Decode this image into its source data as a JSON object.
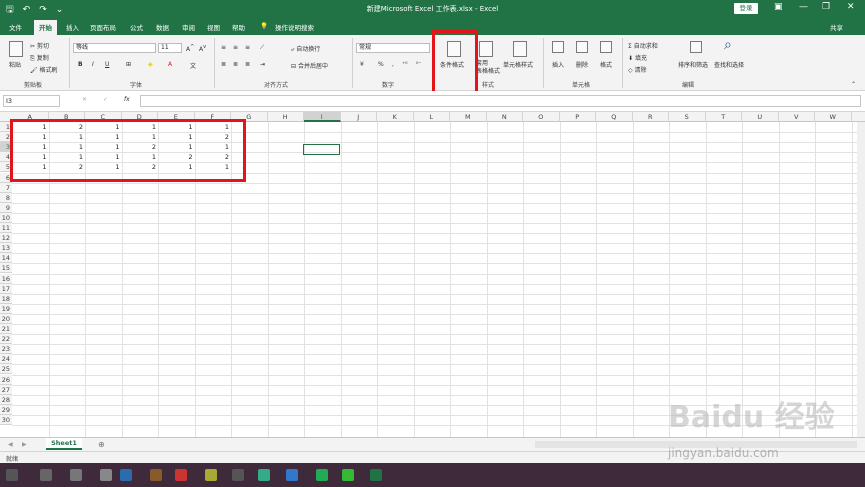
{
  "window": {
    "title": "新建Microsoft Excel 工作表.xlsx  -  Excel",
    "login_label": "登录"
  },
  "tabs": [
    "文件",
    "开始",
    "插入",
    "页面布局",
    "公式",
    "数据",
    "审阅",
    "视图",
    "帮助"
  ],
  "active_tab": "开始",
  "tell_me": "操作说明搜索",
  "share_label": "共享",
  "ribbon": {
    "clipboard": {
      "paste": "粘贴",
      "cut": "剪切",
      "copy": "复制",
      "format_painter": "格式刷",
      "label": "剪贴板"
    },
    "font": {
      "name": "等线",
      "size": "11",
      "label": "字体",
      "bold": "B",
      "italic": "I",
      "underline": "U"
    },
    "alignment": {
      "wrap": "自动换行",
      "merge": "合并后居中",
      "label": "对齐方式"
    },
    "number": {
      "format": "常规",
      "label": "数字"
    },
    "styles": {
      "conditional": "条件格式",
      "table_format": "套用\n表格格式",
      "cell_styles": "单元格样式",
      "label": "样式"
    },
    "cells": {
      "insert": "插入",
      "delete": "删除",
      "format": "格式",
      "label": "单元格"
    },
    "editing": {
      "autosum": "自动求和",
      "fill": "填充",
      "clear": "清除",
      "sort_filter": "排序和筛选",
      "find_select": "查找和选择",
      "label": "编辑"
    }
  },
  "formula_bar": {
    "name_box": "I3",
    "fx": "fx"
  },
  "columns": [
    "A",
    "B",
    "C",
    "D",
    "E",
    "F",
    "G",
    "H",
    "I",
    "J",
    "K",
    "L",
    "M",
    "N",
    "O",
    "P",
    "Q",
    "R",
    "S",
    "T",
    "U",
    "V",
    "W"
  ],
  "rows": [
    "1",
    "2",
    "3",
    "4",
    "5",
    "6",
    "7",
    "8",
    "9",
    "10",
    "11",
    "12",
    "13",
    "14",
    "15",
    "16",
    "17",
    "18",
    "19",
    "20",
    "21",
    "22",
    "23",
    "24",
    "25",
    "26",
    "27",
    "28",
    "29",
    "30"
  ],
  "cells": [
    [
      "1",
      "2",
      "1",
      "1",
      "1",
      "1"
    ],
    [
      "1",
      "1",
      "1",
      "1",
      "1",
      "2"
    ],
    [
      "1",
      "1",
      "1",
      "2",
      "1",
      "1"
    ],
    [
      "1",
      "1",
      "1",
      "1",
      "2",
      "2"
    ],
    [
      "1",
      "2",
      "1",
      "2",
      "1",
      "1"
    ]
  ],
  "sheet_tab": "Sheet1",
  "status": "就绪",
  "watermark": "Baidu 经验",
  "watermark_url": "jingyan.baidu.com",
  "colors": {
    "excel_green": "#217346",
    "highlight_red": "#e4141b"
  }
}
